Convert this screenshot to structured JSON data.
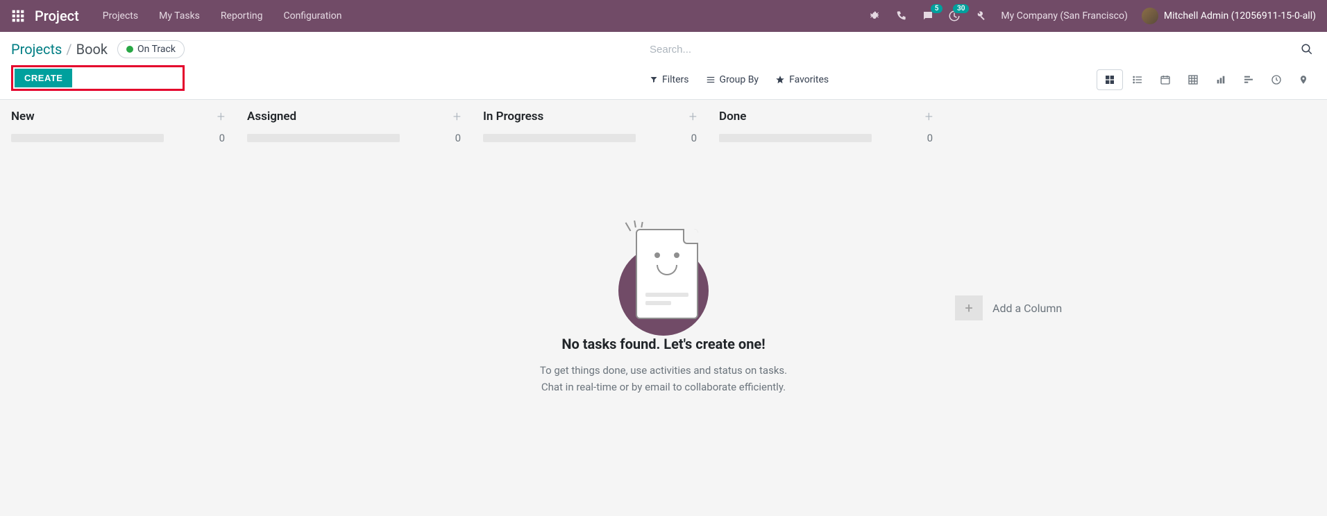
{
  "navbar": {
    "brand": "Project",
    "menu": [
      "Projects",
      "My Tasks",
      "Reporting",
      "Configuration"
    ],
    "messages_badge": "5",
    "activities_badge": "30",
    "company": "My Company (San Francisco)",
    "username": "Mitchell Admin (12056911-15-0-all)"
  },
  "breadcrumb": {
    "parent": "Projects",
    "current": "Book"
  },
  "status": {
    "label": "On Track",
    "color": "#28a745"
  },
  "buttons": {
    "create": "CREATE"
  },
  "search": {
    "placeholder": "Search..."
  },
  "filters": {
    "filters_label": "Filters",
    "groupby_label": "Group By",
    "favorites_label": "Favorites"
  },
  "kanban": {
    "columns": [
      {
        "title": "New",
        "count": "0"
      },
      {
        "title": "Assigned",
        "count": "0"
      },
      {
        "title": "In Progress",
        "count": "0"
      },
      {
        "title": "Done",
        "count": "0"
      }
    ],
    "add_column": "Add a Column"
  },
  "empty": {
    "title": "No tasks found. Let's create one!",
    "line1": "To get things done, use activities and status on tasks.",
    "line2": "Chat in real-time or by email to collaborate efficiently."
  }
}
